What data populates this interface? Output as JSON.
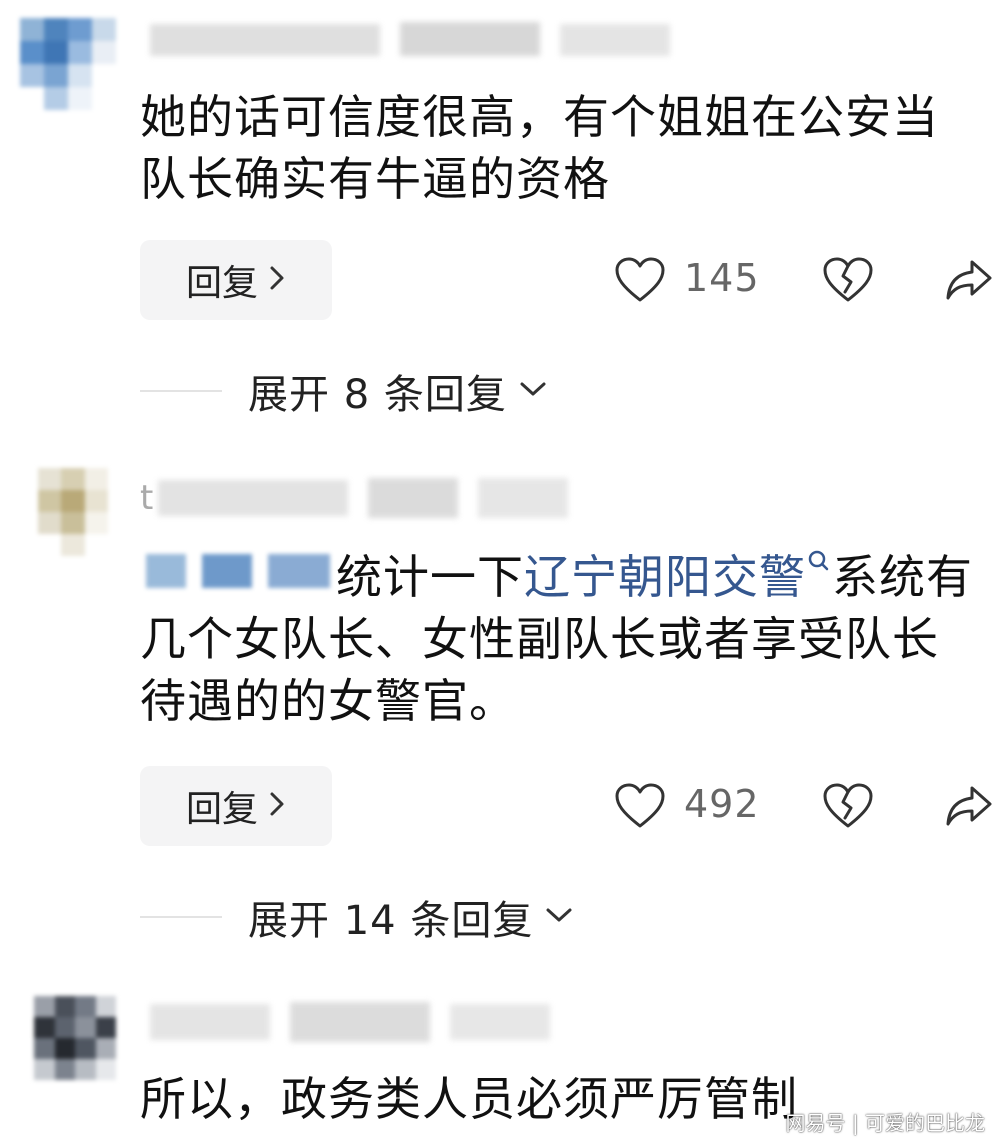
{
  "comments": [
    {
      "text": "她的话可信度很高，有个姐姐在公安当队长确实有牛逼的资格",
      "reply_label": "回复",
      "likes": "145",
      "expand_label": "展开 8 条回复"
    },
    {
      "name_initial": "t",
      "text_prefix": "统计一下",
      "link_text": "辽宁朝阳交警",
      "text_suffix": "系统有几个女队长、女性副队长或者享受队长待遇的的女警官。",
      "reply_label": "回复",
      "likes": "492",
      "expand_label": "展开 14 条回复"
    },
    {
      "text": "所以，政务类人员必须严厉管制"
    }
  ],
  "icons": {
    "like": "heart-outline-icon",
    "dislike": "broken-heart-icon",
    "share": "share-arrow-icon",
    "search": "search-icon",
    "chevron": "chevron-right-icon",
    "expand": "chevron-down-icon"
  },
  "colors": {
    "link": "#35578f",
    "reply_bg": "#f4f4f5",
    "icon": "#333333"
  },
  "watermark": "网易号 | 可爱的巴比龙"
}
